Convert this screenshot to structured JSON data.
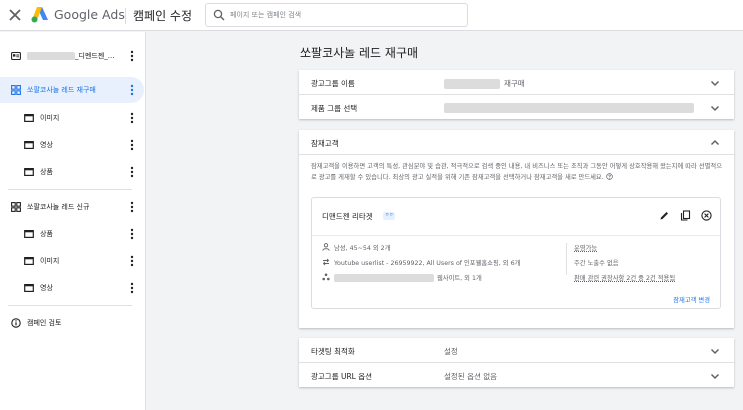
{
  "header": {
    "brand": "Google Ads",
    "page_name": "캠페인 수정",
    "search_placeholder": "페이지 또는 캠페인 검색"
  },
  "sidebar": {
    "account_suffix": "_디멘드젠_...",
    "campaigns": [
      {
        "name": "쏘팔코사놀 레드 재구매",
        "groups": [
          "이미지",
          "영상",
          "상품"
        ]
      },
      {
        "name": "쏘팔코사놀 레드 신규",
        "groups": [
          "상품",
          "이미지",
          "영상"
        ]
      }
    ],
    "review_label": "캠페인 검토"
  },
  "main": {
    "title": "쏘팔코사놀 레드 재구매",
    "ad_group_name_label": "광고그룹 이름",
    "ad_group_name_value": "재구매",
    "product_group_label": "제품 그룹 선택",
    "audience": {
      "section_label": "잠재고객",
      "description": "잠재고객을 이용하면 고객의 특성, 관심분야 및 습관, 적극적으로 검색 중인 내용, 내 비즈니스 또는 조직과 그동안 어떻게 상호작용해 왔는지에 따라 선별적으로 광고를 게재할 수 있습니다. 최상의 광고 실적을 위해 기존 잠재고객을 선택하거나 잠재고객을 새로 만드세요.",
      "card": {
        "name": "디맨드젠 리타겟",
        "badge": "ㅇㅇ",
        "demographics": "남성, 45~54 외 2개",
        "userlist": "Youtube userlist - 26959922, All Users of 인포웰홈쇼핑, 외 6개",
        "websites": "웹사이트, 외 1개",
        "optimization": "운영가능",
        "frequency": "주간 노출수 없음",
        "recommendation": "판매 관련 권장사항 2건 중 2건 적용됨",
        "edit_link": "잠재고객 변경"
      }
    },
    "targeting_label": "타겟팅 최적화",
    "targeting_value": "설정",
    "url_options_label": "광고그룹 URL 옵션",
    "url_options_value": "설정된 옵션 없음"
  }
}
